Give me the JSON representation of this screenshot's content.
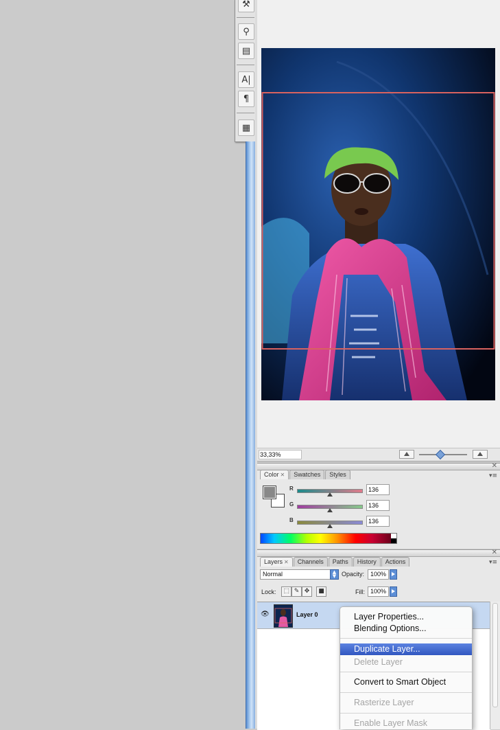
{
  "toolbar": {
    "tools": [
      {
        "icon": "wrench-icon",
        "glyph": "⚒"
      },
      {
        "icon": "clone-source-icon",
        "glyph": "⚲"
      },
      {
        "icon": "layer-comps-icon",
        "glyph": "▤"
      },
      {
        "icon": "character-icon",
        "glyph": "A|"
      },
      {
        "icon": "paragraph-icon",
        "glyph": "¶"
      },
      {
        "icon": "notes-icon",
        "glyph": "▦"
      }
    ]
  },
  "document": {
    "zoom": "33,33%"
  },
  "color_panel": {
    "tabs": [
      {
        "label": "Color",
        "active": true,
        "closable": true
      },
      {
        "label": "Swatches",
        "active": false
      },
      {
        "label": "Styles",
        "active": false
      }
    ],
    "foreground_color": "#888888",
    "background_color": "#ffffff",
    "sliders": [
      {
        "label": "R",
        "value": "136",
        "gradient": [
          "#1a8a8a",
          "#e07a8a"
        ]
      },
      {
        "label": "G",
        "value": "136",
        "gradient": [
          "#a03ca0",
          "#86c98a"
        ]
      },
      {
        "label": "B",
        "value": "136",
        "gradient": [
          "#8a8a3c",
          "#8a8ad8"
        ]
      }
    ]
  },
  "layers_panel": {
    "tabs": [
      {
        "label": "Layers",
        "active": true,
        "closable": true
      },
      {
        "label": "Channels",
        "active": false
      },
      {
        "label": "Paths",
        "active": false
      },
      {
        "label": "History",
        "active": false
      },
      {
        "label": "Actions",
        "active": false
      }
    ],
    "blend_mode": "Normal",
    "opacity_label": "Opacity:",
    "opacity_value": "100%",
    "lock_label": "Lock:",
    "fill_label": "Fill:",
    "fill_value": "100%",
    "layer_name": "Layer 0"
  },
  "context_menu": {
    "items": [
      {
        "label": "Layer Properties...",
        "disabled": false,
        "highlighted": false
      },
      {
        "label": "Blending Options...",
        "disabled": false,
        "highlighted": false
      },
      {
        "label": "Duplicate Layer...",
        "disabled": false,
        "highlighted": true
      },
      {
        "label": "Delete Layer",
        "disabled": true,
        "highlighted": false
      },
      {
        "label": "Convert to Smart Object",
        "disabled": false,
        "highlighted": false
      },
      {
        "label": "Rasterize Layer",
        "disabled": true,
        "highlighted": false
      },
      {
        "label": "Enable Layer Mask",
        "disabled": true,
        "highlighted": false
      }
    ]
  },
  "colors": {
    "accent": "#3c63c8",
    "crop_border": "#d9625f",
    "panel_bg": "#e8e8e8"
  }
}
